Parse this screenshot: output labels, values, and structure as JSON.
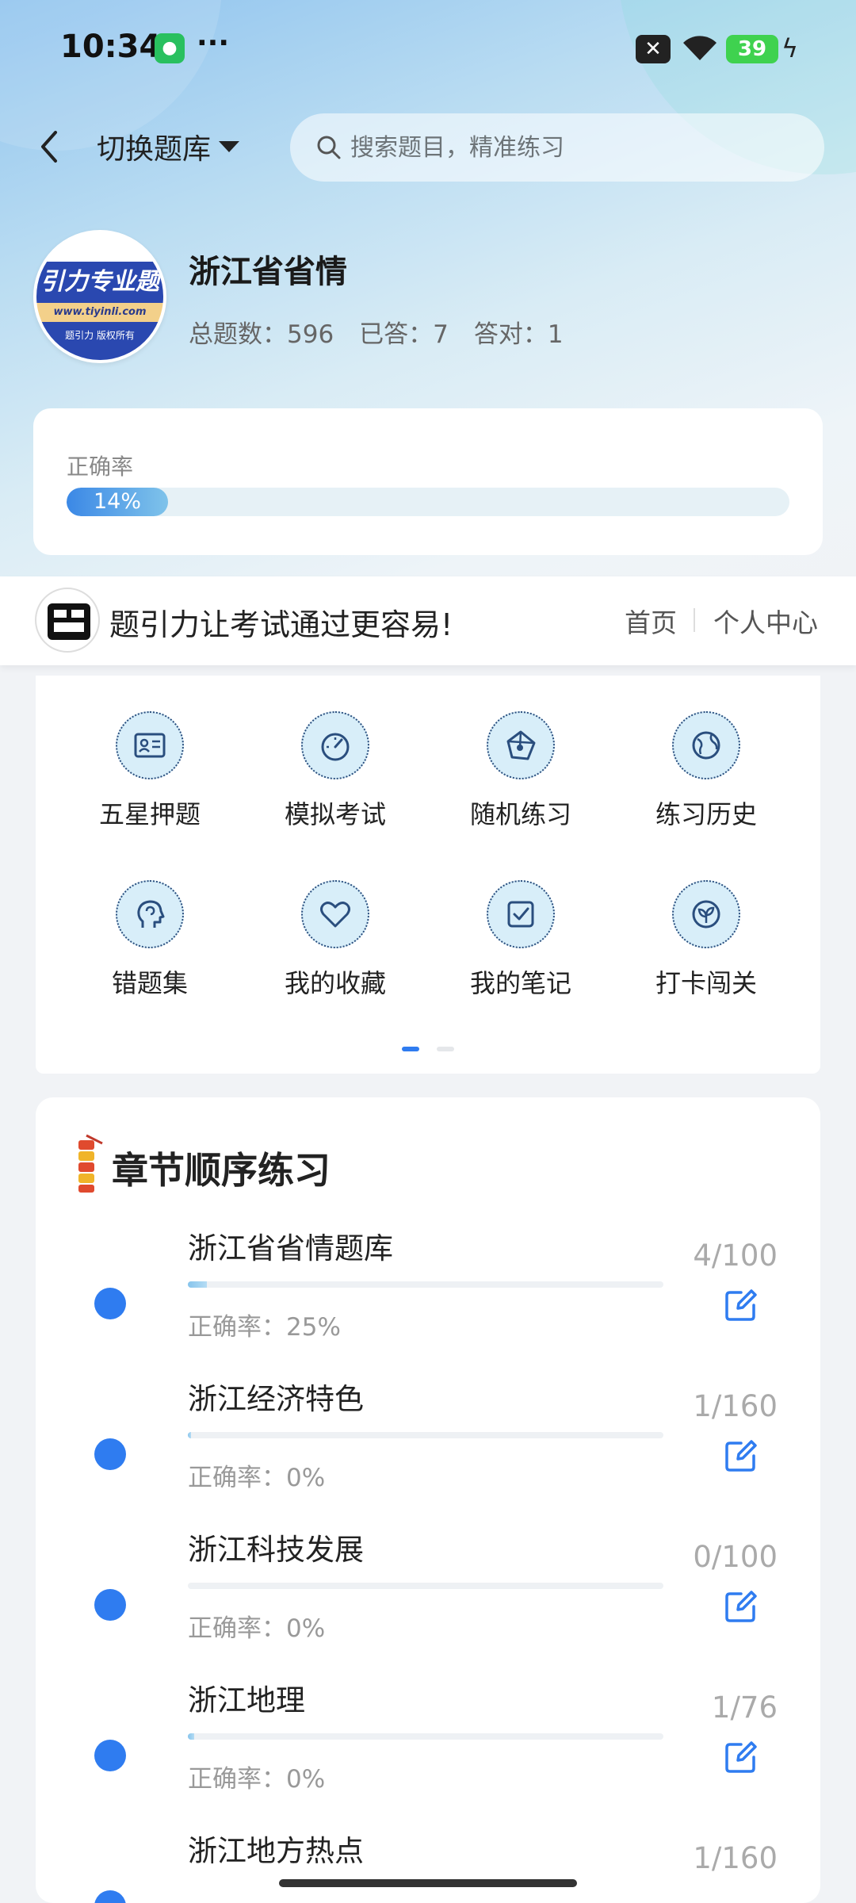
{
  "status_bar": {
    "time": "10:34",
    "more": "···",
    "battery": "39"
  },
  "nav": {
    "switch_label": "切换题库",
    "search_placeholder": "搜索题目，精准练习"
  },
  "bank": {
    "logo_text": "引力专业题",
    "logo_url": "www.tiyinli.com",
    "logo_footer": "题引力 版权所有",
    "title": "浙江省省情",
    "total": "总题数：596",
    "answered": "已答：7",
    "correct": "答对：1"
  },
  "accuracy": {
    "label": "正确率",
    "percent_text": "14%",
    "percent": 14
  },
  "banner": {
    "logo_text": "题引力",
    "text": "题引力让考试通过更容易!",
    "home": "首页",
    "profile": "个人中心"
  },
  "grid": {
    "items": [
      {
        "label": "五星押题",
        "icon": "id-card-icon"
      },
      {
        "label": "模拟考试",
        "icon": "gauge-icon"
      },
      {
        "label": "随机练习",
        "icon": "network-icon"
      },
      {
        "label": "练习历史",
        "icon": "globe-icon"
      },
      {
        "label": "错题集",
        "icon": "head-icon"
      },
      {
        "label": "我的收藏",
        "icon": "heart-icon"
      },
      {
        "label": "我的笔记",
        "icon": "note-check-icon"
      },
      {
        "label": "打卡闯关",
        "icon": "sprout-icon"
      }
    ],
    "page": 1,
    "pages": 2
  },
  "chapters": {
    "title": "章节顺序练习",
    "items": [
      {
        "name": "浙江省省情题库",
        "accuracy": "正确率：25%",
        "count": "4/100",
        "progress": 0.04
      },
      {
        "name": "浙江经济特色",
        "accuracy": "正确率：0%",
        "count": "1/160",
        "progress": 0.00625
      },
      {
        "name": "浙江科技发展",
        "accuracy": "正确率：0%",
        "count": "0/100",
        "progress": 0
      },
      {
        "name": "浙江地理",
        "accuracy": "正确率：0%",
        "count": "1/76",
        "progress": 0.013
      },
      {
        "name": "浙江地方热点",
        "accuracy": "",
        "count": "1/160",
        "progress": 0.00625
      }
    ]
  },
  "colors": {
    "accent": "#2f7cf0",
    "icon_bg": "#d8eef9",
    "icon_stroke": "#2a4e7e"
  }
}
